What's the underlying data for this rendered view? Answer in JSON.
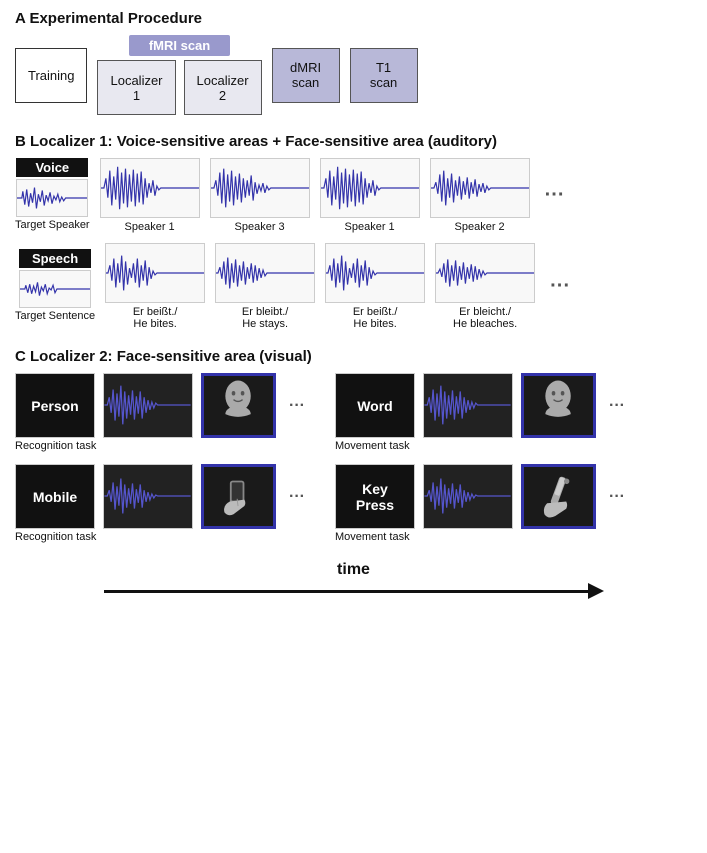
{
  "sectionA": {
    "label": "A  Experimental Procedure",
    "training": "Training",
    "fmriLabel": "fMRI scan",
    "localizer1": "Localizer\n1",
    "localizer2": "Localizer\n2",
    "dmri": "dMRI\nscan",
    "t1": "T1\nscan"
  },
  "sectionB": {
    "label": "B  Localizer 1: Voice-sensitive areas + Face-sensitive area (auditory)",
    "voiceLabel": "Voice",
    "speechLabel": "Speech",
    "targetSpeakerCaption": "Target\nSpeaker",
    "targetSentenceCaption": "Target\nSentence",
    "speakerCaptions": [
      "Speaker 1",
      "Speaker 3",
      "Speaker 1",
      "Speaker 2"
    ],
    "sentenceCaptions": [
      "Er beißt./\nHe bites.",
      "Er bleibt./\nHe stays.",
      "Er beißt./\nHe bites.",
      "Er bleicht./\nHe bleaches."
    ]
  },
  "sectionC": {
    "label": "C  Localizer 2:  Face-sensitive area (visual)",
    "col1": {
      "label1": "Person",
      "caption1": "Recognition task",
      "label2": "Mobile",
      "caption2": "Recognition task"
    },
    "col2": {
      "label1": "Word",
      "caption1": "Movement task",
      "label2": "Key\nPress",
      "caption2": "Movement task"
    }
  },
  "timeLabel": "time"
}
